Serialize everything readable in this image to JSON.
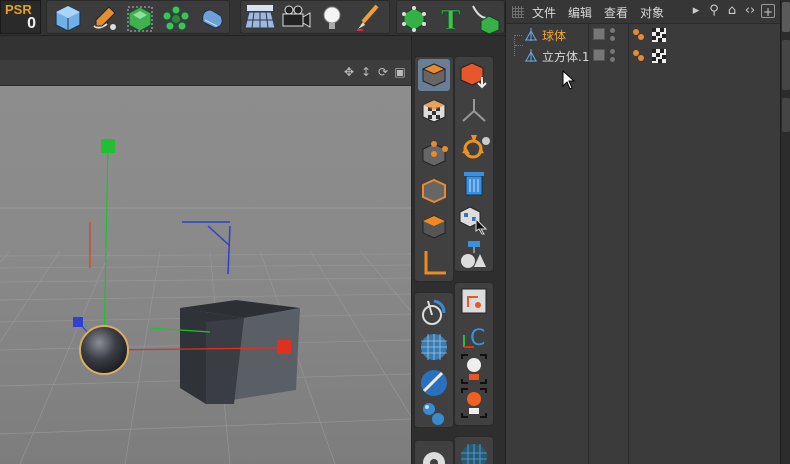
{
  "toolbar": {
    "psr_label": "PSR",
    "psr_value": "0"
  },
  "object_manager": {
    "menu": [
      "文件",
      "编辑",
      "查看",
      "对象"
    ],
    "objects": [
      {
        "name": "球体",
        "selected": true
      },
      {
        "name": "立方体.1",
        "selected": false
      }
    ]
  },
  "colors": {
    "accent_orange": "#f2a430",
    "axis_x": "#e03020",
    "axis_y": "#20c030",
    "axis_z": "#3040d0",
    "active_button": "#6a7f96"
  },
  "icons": {
    "top_toolbar": [
      "cube-icon",
      "pen-icon",
      "subdivision-icon",
      "cloner-icon",
      "deformer-icon",
      "floor-grid-icon",
      "camera-icon",
      "light-icon",
      "paint-brush-icon",
      "snap-icon",
      "text-icon",
      "extrude-icon"
    ],
    "palette_left": [
      "object-mode-cube-icon",
      "texture-mode-icon",
      "point-mode-icon",
      "edge-mode-icon",
      "polygon-mode-icon",
      "axis-mode-icon",
      "snap-settings-icon",
      "grid-sphere-icon",
      "material-sphere-icon",
      "spheres-icon",
      "gear-icon"
    ],
    "palette_right": [
      "make-editable-icon",
      "connect-icon",
      "recycle-gear-icon",
      "trash-icon",
      "select-object-icon",
      "tag-icon",
      "uv-edit-icon",
      "coordinates-icon",
      "joint-icon",
      "joint-orange-icon",
      "grid-ball-icon"
    ]
  }
}
